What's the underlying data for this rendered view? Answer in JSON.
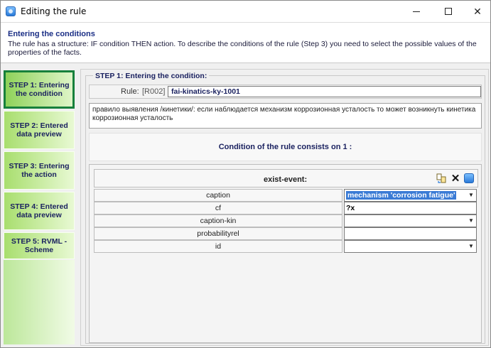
{
  "window": {
    "title": "Editing the rule"
  },
  "header": {
    "title": "Entering the conditions",
    "description": "The rule has a structure: IF condition THEN action. To describe the conditions of the rule (Step 3) you need to select the possible values of the properties of the facts."
  },
  "steps": [
    {
      "label": "STEP 1: Entering the condition",
      "active": true
    },
    {
      "label": "STEP 2: Entered data preview",
      "active": false
    },
    {
      "label": "STEP 3: Entering the action",
      "active": false
    },
    {
      "label": "STEP 4: Entered data preview",
      "active": false
    },
    {
      "label": "STEP 5: RVML - Scheme",
      "active": false
    }
  ],
  "main": {
    "legend": "STEP 1: Entering the condition:",
    "rule_label": "Rule:",
    "rule_code": "[R002]",
    "rule_name": "fai-kinatics-ky-1001",
    "rule_description": "правило выявления /кинетики/: если наблюдается механизм коррозионная усталость то может возникнуть кинетика коррозионная усталость",
    "condition_summary": "Condition of the rule consists on 1 :",
    "event": {
      "name": "exist-event:",
      "properties": [
        {
          "name": "caption",
          "value": "mechanism 'corrosion fatigue'",
          "has_dropdown": true,
          "selected": true
        },
        {
          "name": "cf",
          "value": "?x",
          "has_dropdown": false,
          "selected": false
        },
        {
          "name": "caption-kin",
          "value": "",
          "has_dropdown": true,
          "selected": false
        },
        {
          "name": "probabilityrel",
          "value": "",
          "has_dropdown": false,
          "selected": false
        },
        {
          "name": "id",
          "value": "",
          "has_dropdown": true,
          "selected": false
        }
      ]
    }
  },
  "icons": {
    "app": "app-icon",
    "move": "move-icon",
    "delete": "close-icon",
    "edit": "app-icon"
  }
}
